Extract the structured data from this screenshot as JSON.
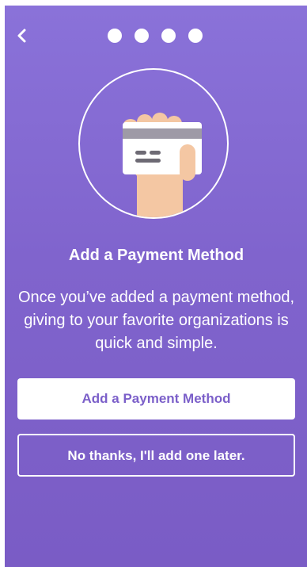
{
  "header": {
    "back_icon": "chevron-left-icon",
    "page_indicator_count": 4
  },
  "illustration": {
    "icon": "hand-holding-card-icon"
  },
  "content": {
    "title": "Add a Payment Method",
    "description": "Once you’ve added a payment method, giving to your favorite organizations is quick and simple."
  },
  "actions": {
    "primary_label": "Add a Payment Method",
    "secondary_label": "No thanks, I'll add one later."
  },
  "colors": {
    "background_top": "#8a72d9",
    "background_bottom": "#7a5cc5",
    "primary_button_text": "#7b5fc9",
    "card": "#ffffff",
    "card_stripe": "#9e9aa6",
    "skin": "#f4c7a3"
  }
}
